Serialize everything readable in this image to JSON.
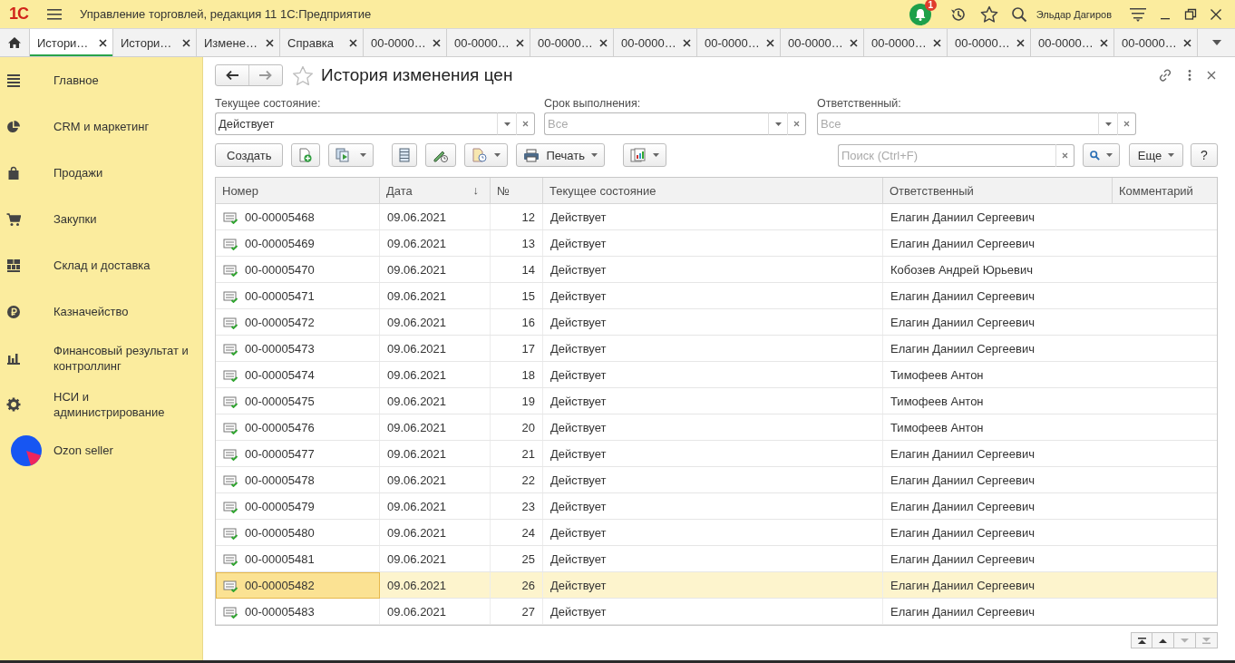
{
  "window": {
    "logo": "1С",
    "title": "Управление торговлей, редакция 11 1С:Предприятие",
    "notifications": "1",
    "user": "Эльдар Дагиров"
  },
  "tabs": [
    {
      "label": "Истори…",
      "selected": true
    },
    {
      "label": "Истори…",
      "selected": false
    },
    {
      "label": "Измене…",
      "selected": false
    },
    {
      "label": "Справка",
      "selected": false
    },
    {
      "label": "00-0000…",
      "selected": false
    },
    {
      "label": "00-0000…",
      "selected": false
    },
    {
      "label": "00-0000…",
      "selected": false
    },
    {
      "label": "00-0000…",
      "selected": false
    },
    {
      "label": "00-0000…",
      "selected": false
    },
    {
      "label": "00-0000…",
      "selected": false
    },
    {
      "label": "00-0000…",
      "selected": false
    },
    {
      "label": "00-0000…",
      "selected": false
    },
    {
      "label": "00-0000…",
      "selected": false
    },
    {
      "label": "00-0000…",
      "selected": false
    }
  ],
  "sidebar": {
    "items": [
      {
        "label": "Главное"
      },
      {
        "label": "CRM и маркетинг"
      },
      {
        "label": "Продажи"
      },
      {
        "label": "Закупки"
      },
      {
        "label": "Склад и доставка"
      },
      {
        "label": "Казначейство"
      },
      {
        "label": "Финансовый результат и контроллинг"
      },
      {
        "label": "НСИ и администрирование"
      },
      {
        "label": "Ozon seller"
      }
    ]
  },
  "form": {
    "title": "История изменения цен",
    "filters": [
      {
        "label": "Текущее состояние:",
        "value": "Действует"
      },
      {
        "label": "Срок выполнения:",
        "placeholder": "Все"
      },
      {
        "label": "Ответственный:",
        "placeholder": "Все"
      }
    ],
    "toolbar": {
      "groups": [
        [
          {
            "kind": "text",
            "label": "Создать",
            "dropdown": false
          },
          {
            "kind": "icon",
            "dropdown": false
          },
          {
            "kind": "icon",
            "dropdown": true
          }
        ],
        [
          {
            "kind": "icon",
            "dropdown": false
          },
          {
            "kind": "icon",
            "dropdown": false
          },
          {
            "kind": "icon",
            "dropdown": true
          },
          {
            "kind": "icon_text",
            "label": "Печать",
            "dropdown": true
          }
        ],
        [
          {
            "kind": "icon",
            "dropdown": true
          }
        ]
      ],
      "search": {
        "placeholder": "Поиск (Ctrl+F)"
      },
      "more": "Еще",
      "help": "?"
    }
  },
  "table": {
    "columns": [
      {
        "label": "Номер"
      },
      {
        "label": "Дата",
        "sort_mark": "↓"
      },
      {
        "label": "№"
      },
      {
        "label": "Текущее состояние"
      },
      {
        "label": "Ответственный"
      },
      {
        "label": "Комментарий"
      }
    ],
    "rows": [
      {
        "number": "00-00005468",
        "date": "09.06.2021",
        "no": "12",
        "state": "Действует",
        "responsible": "Елагин Даниил Сергеевич",
        "posted": true,
        "selected": false
      },
      {
        "number": "00-00005469",
        "date": "09.06.2021",
        "no": "13",
        "state": "Действует",
        "responsible": "Елагин Даниил Сергеевич",
        "posted": true,
        "selected": false
      },
      {
        "number": "00-00005470",
        "date": "09.06.2021",
        "no": "14",
        "state": "Действует",
        "responsible": "Кобозев Андрей Юрьевич",
        "posted": true,
        "selected": false
      },
      {
        "number": "00-00005471",
        "date": "09.06.2021",
        "no": "15",
        "state": "Действует",
        "responsible": "Елагин Даниил Сергеевич",
        "posted": true,
        "selected": false
      },
      {
        "number": "00-00005472",
        "date": "09.06.2021",
        "no": "16",
        "state": "Действует",
        "responsible": "Елагин Даниил Сергеевич",
        "posted": true,
        "selected": false
      },
      {
        "number": "00-00005473",
        "date": "09.06.2021",
        "no": "17",
        "state": "Действует",
        "responsible": "Елагин Даниил Сергеевич",
        "posted": true,
        "selected": false
      },
      {
        "number": "00-00005474",
        "date": "09.06.2021",
        "no": "18",
        "state": "Действует",
        "responsible": "Тимофеев Антон",
        "posted": true,
        "selected": false
      },
      {
        "number": "00-00005475",
        "date": "09.06.2021",
        "no": "19",
        "state": "Действует",
        "responsible": "Тимофеев Антон",
        "posted": true,
        "selected": false
      },
      {
        "number": "00-00005476",
        "date": "09.06.2021",
        "no": "20",
        "state": "Действует",
        "responsible": "Тимофеев Антон",
        "posted": true,
        "selected": false
      },
      {
        "number": "00-00005477",
        "date": "09.06.2021",
        "no": "21",
        "state": "Действует",
        "responsible": "Елагин Даниил Сергеевич",
        "posted": true,
        "selected": false
      },
      {
        "number": "00-00005478",
        "date": "09.06.2021",
        "no": "22",
        "state": "Действует",
        "responsible": "Елагин Даниил Сергеевич",
        "posted": true,
        "selected": false
      },
      {
        "number": "00-00005479",
        "date": "09.06.2021",
        "no": "23",
        "state": "Действует",
        "responsible": "Елагин Даниил Сергеевич",
        "posted": true,
        "selected": false
      },
      {
        "number": "00-00005480",
        "date": "09.06.2021",
        "no": "24",
        "state": "Действует",
        "responsible": "Елагин Даниил Сергеевич",
        "posted": true,
        "selected": false
      },
      {
        "number": "00-00005481",
        "date": "09.06.2021",
        "no": "25",
        "state": "Действует",
        "responsible": "Елагин Даниил Сергеевич",
        "posted": true,
        "selected": false
      },
      {
        "number": "00-00005482",
        "date": "09.06.2021",
        "no": "26",
        "state": "Действует",
        "responsible": "Елагин Даниил Сергеевич",
        "posted": true,
        "selected": true
      },
      {
        "number": "00-00005483",
        "date": "09.06.2021",
        "no": "27",
        "state": "Действует",
        "responsible": "Елагин Даниил Сергеевич",
        "posted": true,
        "selected": false
      }
    ]
  },
  "pager": [
    {
      "disabled": false
    },
    {
      "disabled": false
    },
    {
      "disabled": true
    },
    {
      "disabled": true
    }
  ]
}
